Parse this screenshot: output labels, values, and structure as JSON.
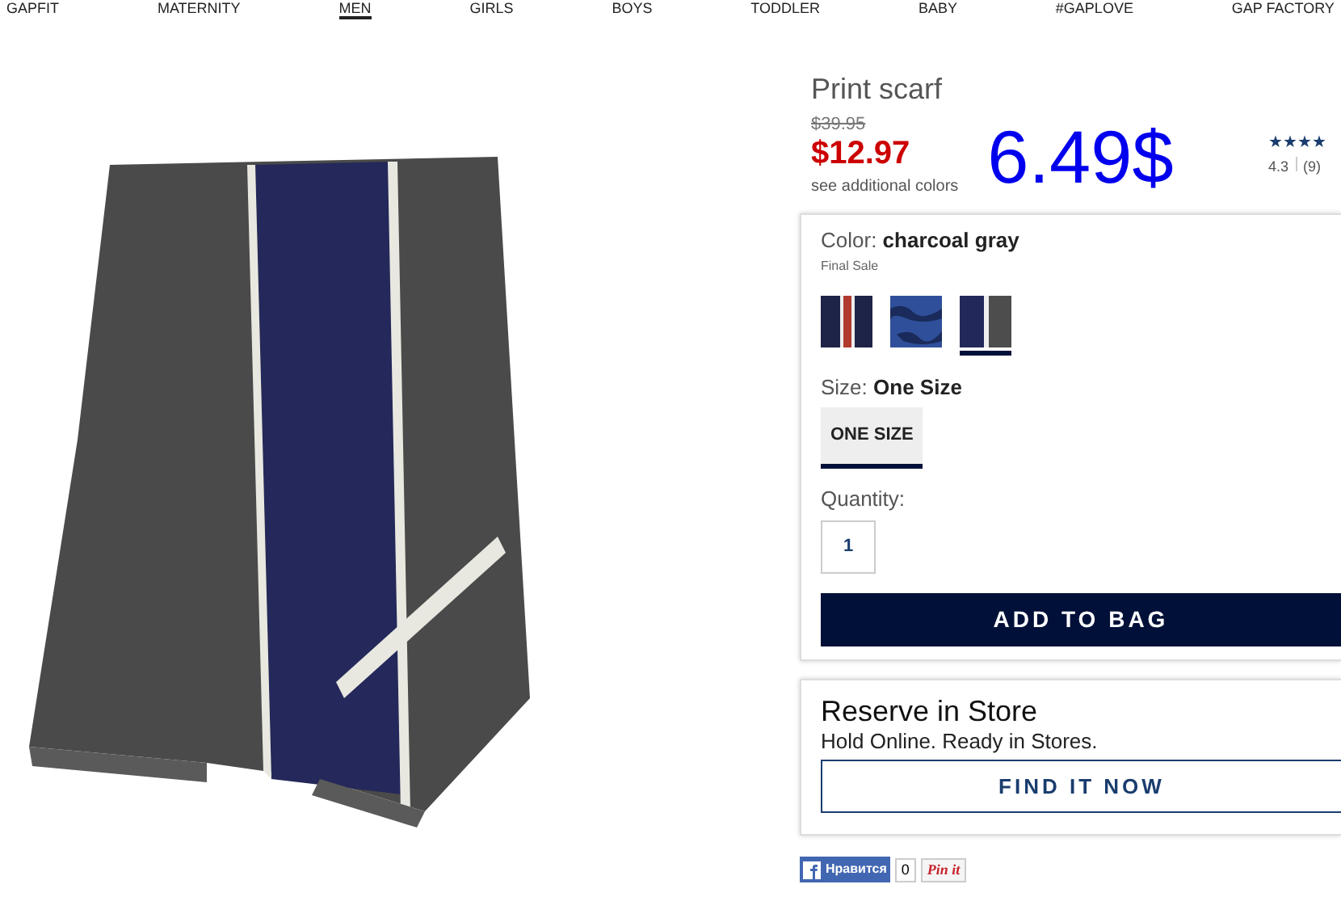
{
  "nav": [
    {
      "label": "GAPFIT",
      "selected": false
    },
    {
      "label": "MATERNITY",
      "selected": false
    },
    {
      "label": "MEN",
      "selected": true
    },
    {
      "label": "GIRLS",
      "selected": false
    },
    {
      "label": "BOYS",
      "selected": false
    },
    {
      "label": "TODDLER",
      "selected": false
    },
    {
      "label": "BABY",
      "selected": false
    },
    {
      "label": "#GAPLOVE",
      "selected": false
    },
    {
      "label": "GAP FACTORY",
      "selected": false
    }
  ],
  "product": {
    "title": "Print scarf",
    "old_price": "$39.95",
    "price": "$12.97",
    "see_colors": "see additional colors",
    "overlay_price": "6.49$",
    "stars": 4,
    "rating": "4.3",
    "reviews": "(9)"
  },
  "options": {
    "color_label": "Color:",
    "color_value": "charcoal gray",
    "final_sale": "Final Sale",
    "swatches": [
      {
        "kind": "redstripe",
        "selected": false
      },
      {
        "kind": "camo",
        "selected": false
      },
      {
        "kind": "charcoal",
        "selected": true
      }
    ],
    "size_label": "Size:",
    "size_value": "One Size",
    "sizes": [
      {
        "label": "ONE SIZE",
        "selected": true
      }
    ],
    "quantity_label": "Quantity:",
    "quantity": "1",
    "add_button": "ADD TO BAG"
  },
  "store": {
    "title": "Reserve in Store",
    "subtitle": "Hold Online. Ready in Stores.",
    "button": "FIND IT NOW"
  },
  "social": {
    "like": "Нравится",
    "count": "0",
    "pin": "Pin it"
  }
}
